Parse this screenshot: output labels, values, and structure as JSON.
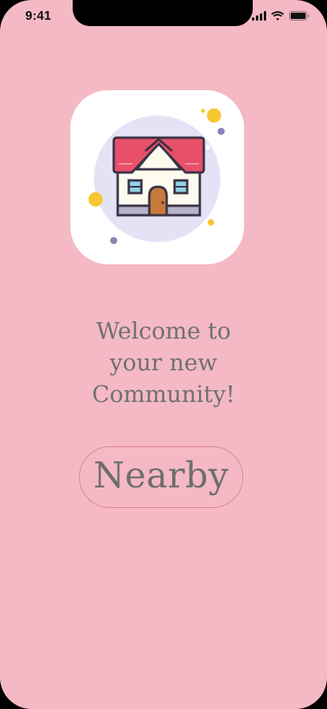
{
  "status_bar": {
    "time": "9:41",
    "icons": [
      "cellular-signal-icon",
      "wifi-icon",
      "battery-icon"
    ]
  },
  "app_icon": {
    "name": "house-icon"
  },
  "main": {
    "welcome_text": "Welcome to\nyour new\nCommunity!",
    "nearby_button_label": "Nearby"
  },
  "colors": {
    "background": "#f4b9c4",
    "text": "#707070",
    "button_border": "#d9828f",
    "roof": "#e8506a",
    "icon_circle": "#e4e3f6",
    "accent_yellow": "#f7c631",
    "accent_purple": "#8e82b5"
  }
}
